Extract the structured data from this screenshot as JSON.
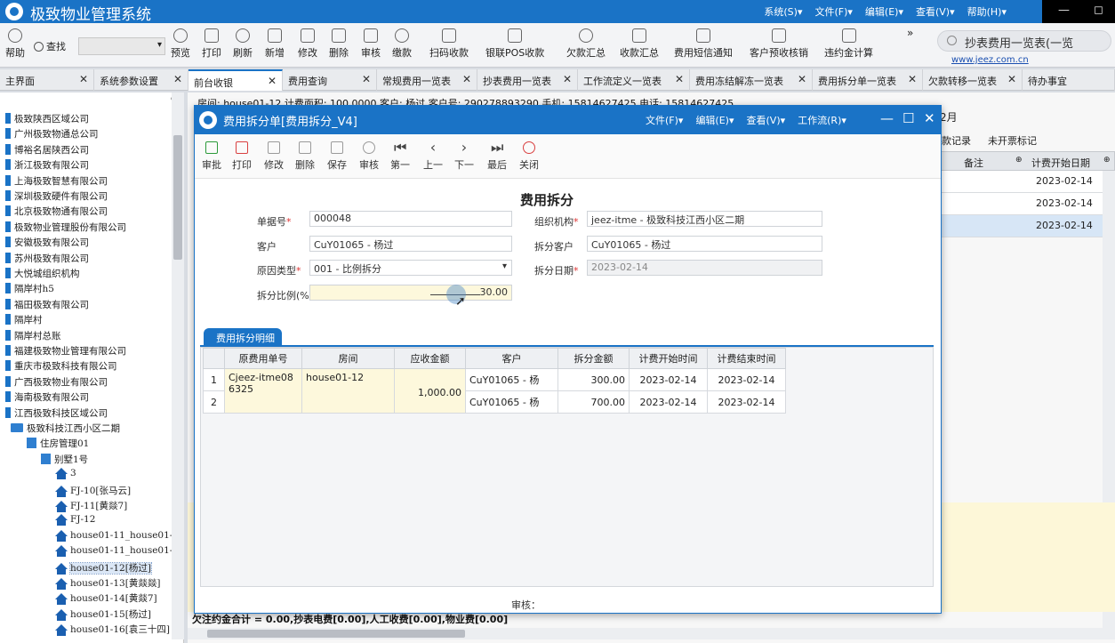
{
  "app": {
    "title": "极致物业管理系统",
    "menus": [
      "系统(S)▾",
      "文件(F)▾",
      "编辑(E)▾",
      "查看(V)▾",
      "帮助(H)▾"
    ],
    "window_controls": [
      "—",
      "◻"
    ]
  },
  "toolbar": {
    "items": [
      "帮助",
      "查找",
      "预览",
      "打印",
      "刷新",
      "新增",
      "修改",
      "删除",
      "审核",
      "缴款",
      "扫码收款",
      "银联POS收款",
      "欠款汇总",
      "收款汇总",
      "费用短信通知",
      "客户预收核销",
      "违约金计算"
    ],
    "more": "»",
    "search_text": "抄表费用一览表(一览",
    "site_link": "www.jeez.com.cn"
  },
  "tabs": [
    {
      "label": "主界面"
    },
    {
      "label": "系统参数设置"
    },
    {
      "label": "前台收银"
    },
    {
      "label": "费用查询"
    },
    {
      "label": "常规费用一览表"
    },
    {
      "label": "抄表费用一览表"
    },
    {
      "label": "工作流定义一览表"
    },
    {
      "label": "费用冻结解冻一览表"
    },
    {
      "label": "费用拆分单一览表"
    },
    {
      "label": "欠款转移一览表"
    },
    {
      "label": "待办事宜"
    }
  ],
  "tree": {
    "pin": "⊕",
    "companies": [
      "极致陕西区域公司",
      "广州极致物通总公司",
      "博裕名居陕西公司",
      "浙江极致有限公司",
      "上海极致智慧有限公司",
      "深圳极致硬件有限公司",
      "北京极致物通有限公司",
      "极致物业管理股份有限公司",
      "安徽极致有限公司",
      "苏州极致有限公司",
      "大悦城组织机构",
      "隔岸村h5",
      "福田极致有限公司",
      "隔岸村",
      "隔岸村总账",
      "福建极致物业管理有限公司",
      "重庆市极致科技有限公司",
      "广西极致物业有限公司",
      "海南极致有限公司",
      "江西极致科技区域公司"
    ],
    "project": "极致科技江西小区二期",
    "building_group": "住房管理01",
    "building": "别墅1号",
    "houses": [
      "3",
      "FJ-10[张马云]",
      "FJ-11[黄燚7]",
      "FJ-12",
      "house01-11_house01-1",
      "house01-11_house01-1",
      "house01-12[杨过]",
      "house01-13[黄燚燚]",
      "house01-14[黄燚7]",
      "house01-15[杨过]",
      "house01-16[袁三十四]"
    ],
    "selected_house": "house01-12[杨过]"
  },
  "background": {
    "info_line": "房间: house01-12    计费面积: 100.0000 客户: 杨过 客户号: 290278893290 手机: 15814627425 电话: 15814627425",
    "month_label": "2月",
    "subtabs": [
      "款记录",
      "未开票标记"
    ],
    "grid_headers": [
      "备注",
      "计费开始日期"
    ],
    "grid_dates": [
      "2023-02-14",
      "2023-02-14",
      "2023-02-14"
    ],
    "footer": "欠注约金合计 = 0.00,抄表电费[0.00],人工收费[0.00],物业费[0.00]"
  },
  "modal": {
    "title": "费用拆分单[费用拆分_V4]",
    "menus": [
      "文件(F)▾",
      "编辑(E)▾",
      "查看(V)▾",
      "工作流(R)▾"
    ],
    "toolbar": [
      "审批",
      "打印",
      "修改",
      "删除",
      "保存",
      "审核",
      "第一",
      "上一",
      "下一",
      "最后",
      "关闭"
    ],
    "form_title": "费用拆分",
    "fields": {
      "doc_no": {
        "label": "单据号",
        "value": "000048"
      },
      "org": {
        "label": "组织机构",
        "value": "jeez-itme  - 极致科技江西小区二期"
      },
      "customer": {
        "label": "客户",
        "value": "CuY01065  - 杨过"
      },
      "split_customer": {
        "label": "拆分客户",
        "value": "CuY01065  - 杨过"
      },
      "reason_type": {
        "label": "原因类型",
        "value": "001 - 比例拆分"
      },
      "split_date": {
        "label": "拆分日期",
        "value": "2023-02-14"
      },
      "split_ratio": {
        "label": "拆分比例(%",
        "value": "30.00"
      }
    },
    "detail_tab": "费用拆分明细",
    "detail_columns": [
      "",
      "原费用单号",
      "房间",
      "应收金额",
      "客户",
      "拆分金额",
      "计费开始时间",
      "计费结束时间"
    ],
    "detail_rows": [
      {
        "idx": "1",
        "orig_no": "Cjeez-itme086325",
        "room": "house01-12",
        "receivable": "1,000.00",
        "customer": "CuY01065  - 杨",
        "split_amount": "300.00",
        "start": "2023-02-14",
        "end": "2023-02-14"
      },
      {
        "idx": "2",
        "customer": "CuY01065  - 杨",
        "split_amount": "700.00",
        "start": "2023-02-14",
        "end": "2023-02-14"
      }
    ],
    "auditor_label": "审核："
  }
}
